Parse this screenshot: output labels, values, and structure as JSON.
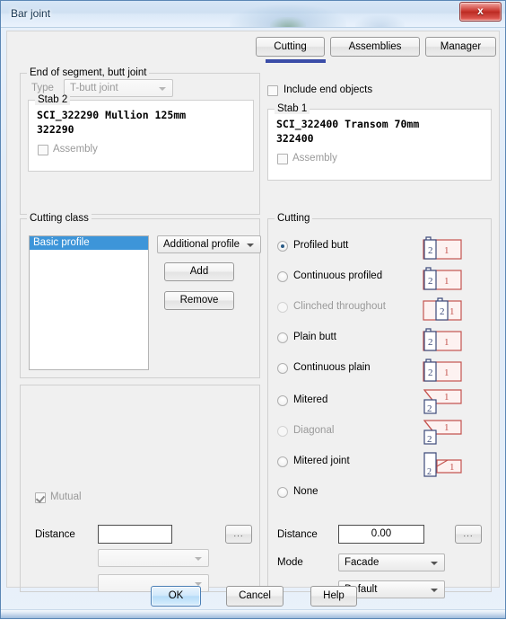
{
  "window": {
    "title": "Bar joint",
    "close_label": "x"
  },
  "tabs": [
    {
      "label": "Cutting",
      "active": true
    },
    {
      "label": "Assemblies",
      "active": false
    },
    {
      "label": "Manager",
      "active": false
    }
  ],
  "end_of_segment": {
    "group_label": "End of segment, butt joint",
    "type_label": "Type",
    "type_value": "T-butt joint",
    "include_end_objects_label": "Include end objects",
    "stab2": {
      "group_label": "Stab 2",
      "line1": "SCI_322290 Mullion 125mm",
      "line2": "322290",
      "assembly_label": "Assembly"
    },
    "stab1": {
      "group_label": "Stab 1",
      "line1": "SCI_322400 Transom 70mm",
      "line2": "322400",
      "assembly_label": "Assembly"
    }
  },
  "cutting_class": {
    "group_label": "Cutting class",
    "list_items": [
      "Basic profile"
    ],
    "profile_select_value": "Additional profile",
    "add_label": "Add",
    "remove_label": "Remove"
  },
  "cutting": {
    "group_label": "Cutting",
    "options": [
      {
        "label": "Profiled butt",
        "selected": true,
        "disabled": false,
        "icon": "joint-profiled-butt-icon"
      },
      {
        "label": "Continuous profiled",
        "selected": false,
        "disabled": false,
        "icon": "joint-continuous-profiled-icon"
      },
      {
        "label": "Clinched throughout",
        "selected": false,
        "disabled": true,
        "icon": "joint-clinched-throughout-icon"
      },
      {
        "label": "Plain butt",
        "selected": false,
        "disabled": false,
        "icon": "joint-plain-butt-icon"
      },
      {
        "label": "Continuous plain",
        "selected": false,
        "disabled": false,
        "icon": "joint-continuous-plain-icon"
      },
      {
        "label": "Mitered",
        "selected": false,
        "disabled": false,
        "icon": "joint-mitered-icon"
      },
      {
        "label": "Diagonal",
        "selected": false,
        "disabled": true,
        "icon": "joint-diagonal-icon"
      },
      {
        "label": "Mitered joint",
        "selected": false,
        "disabled": false,
        "icon": "joint-mitered-joint-icon"
      },
      {
        "label": "None",
        "selected": false,
        "disabled": false,
        "icon": null
      }
    ],
    "distance_label": "Distance",
    "distance_value": "0.00",
    "browse_label": "...",
    "mode_label": "Mode",
    "mode_value": "Facade",
    "preset_value": "Default",
    "icon_part_labels": {
      "part1": "1",
      "part2": "2"
    }
  },
  "lower_left": {
    "mutual_label": "Mutual",
    "distance_label": "Distance",
    "distance_value": "",
    "browse_label": "...",
    "combo1_value": "",
    "combo2_value": ""
  },
  "footer": {
    "ok_label": "OK",
    "cancel_label": "Cancel",
    "help_label": "Help"
  },
  "colors": {
    "accent_blue": "#3b4da8",
    "selection_blue": "#3d95d9",
    "icon_red": "#c4544f",
    "icon_navy": "#3c4a7a",
    "close_red": "#c62f27"
  }
}
